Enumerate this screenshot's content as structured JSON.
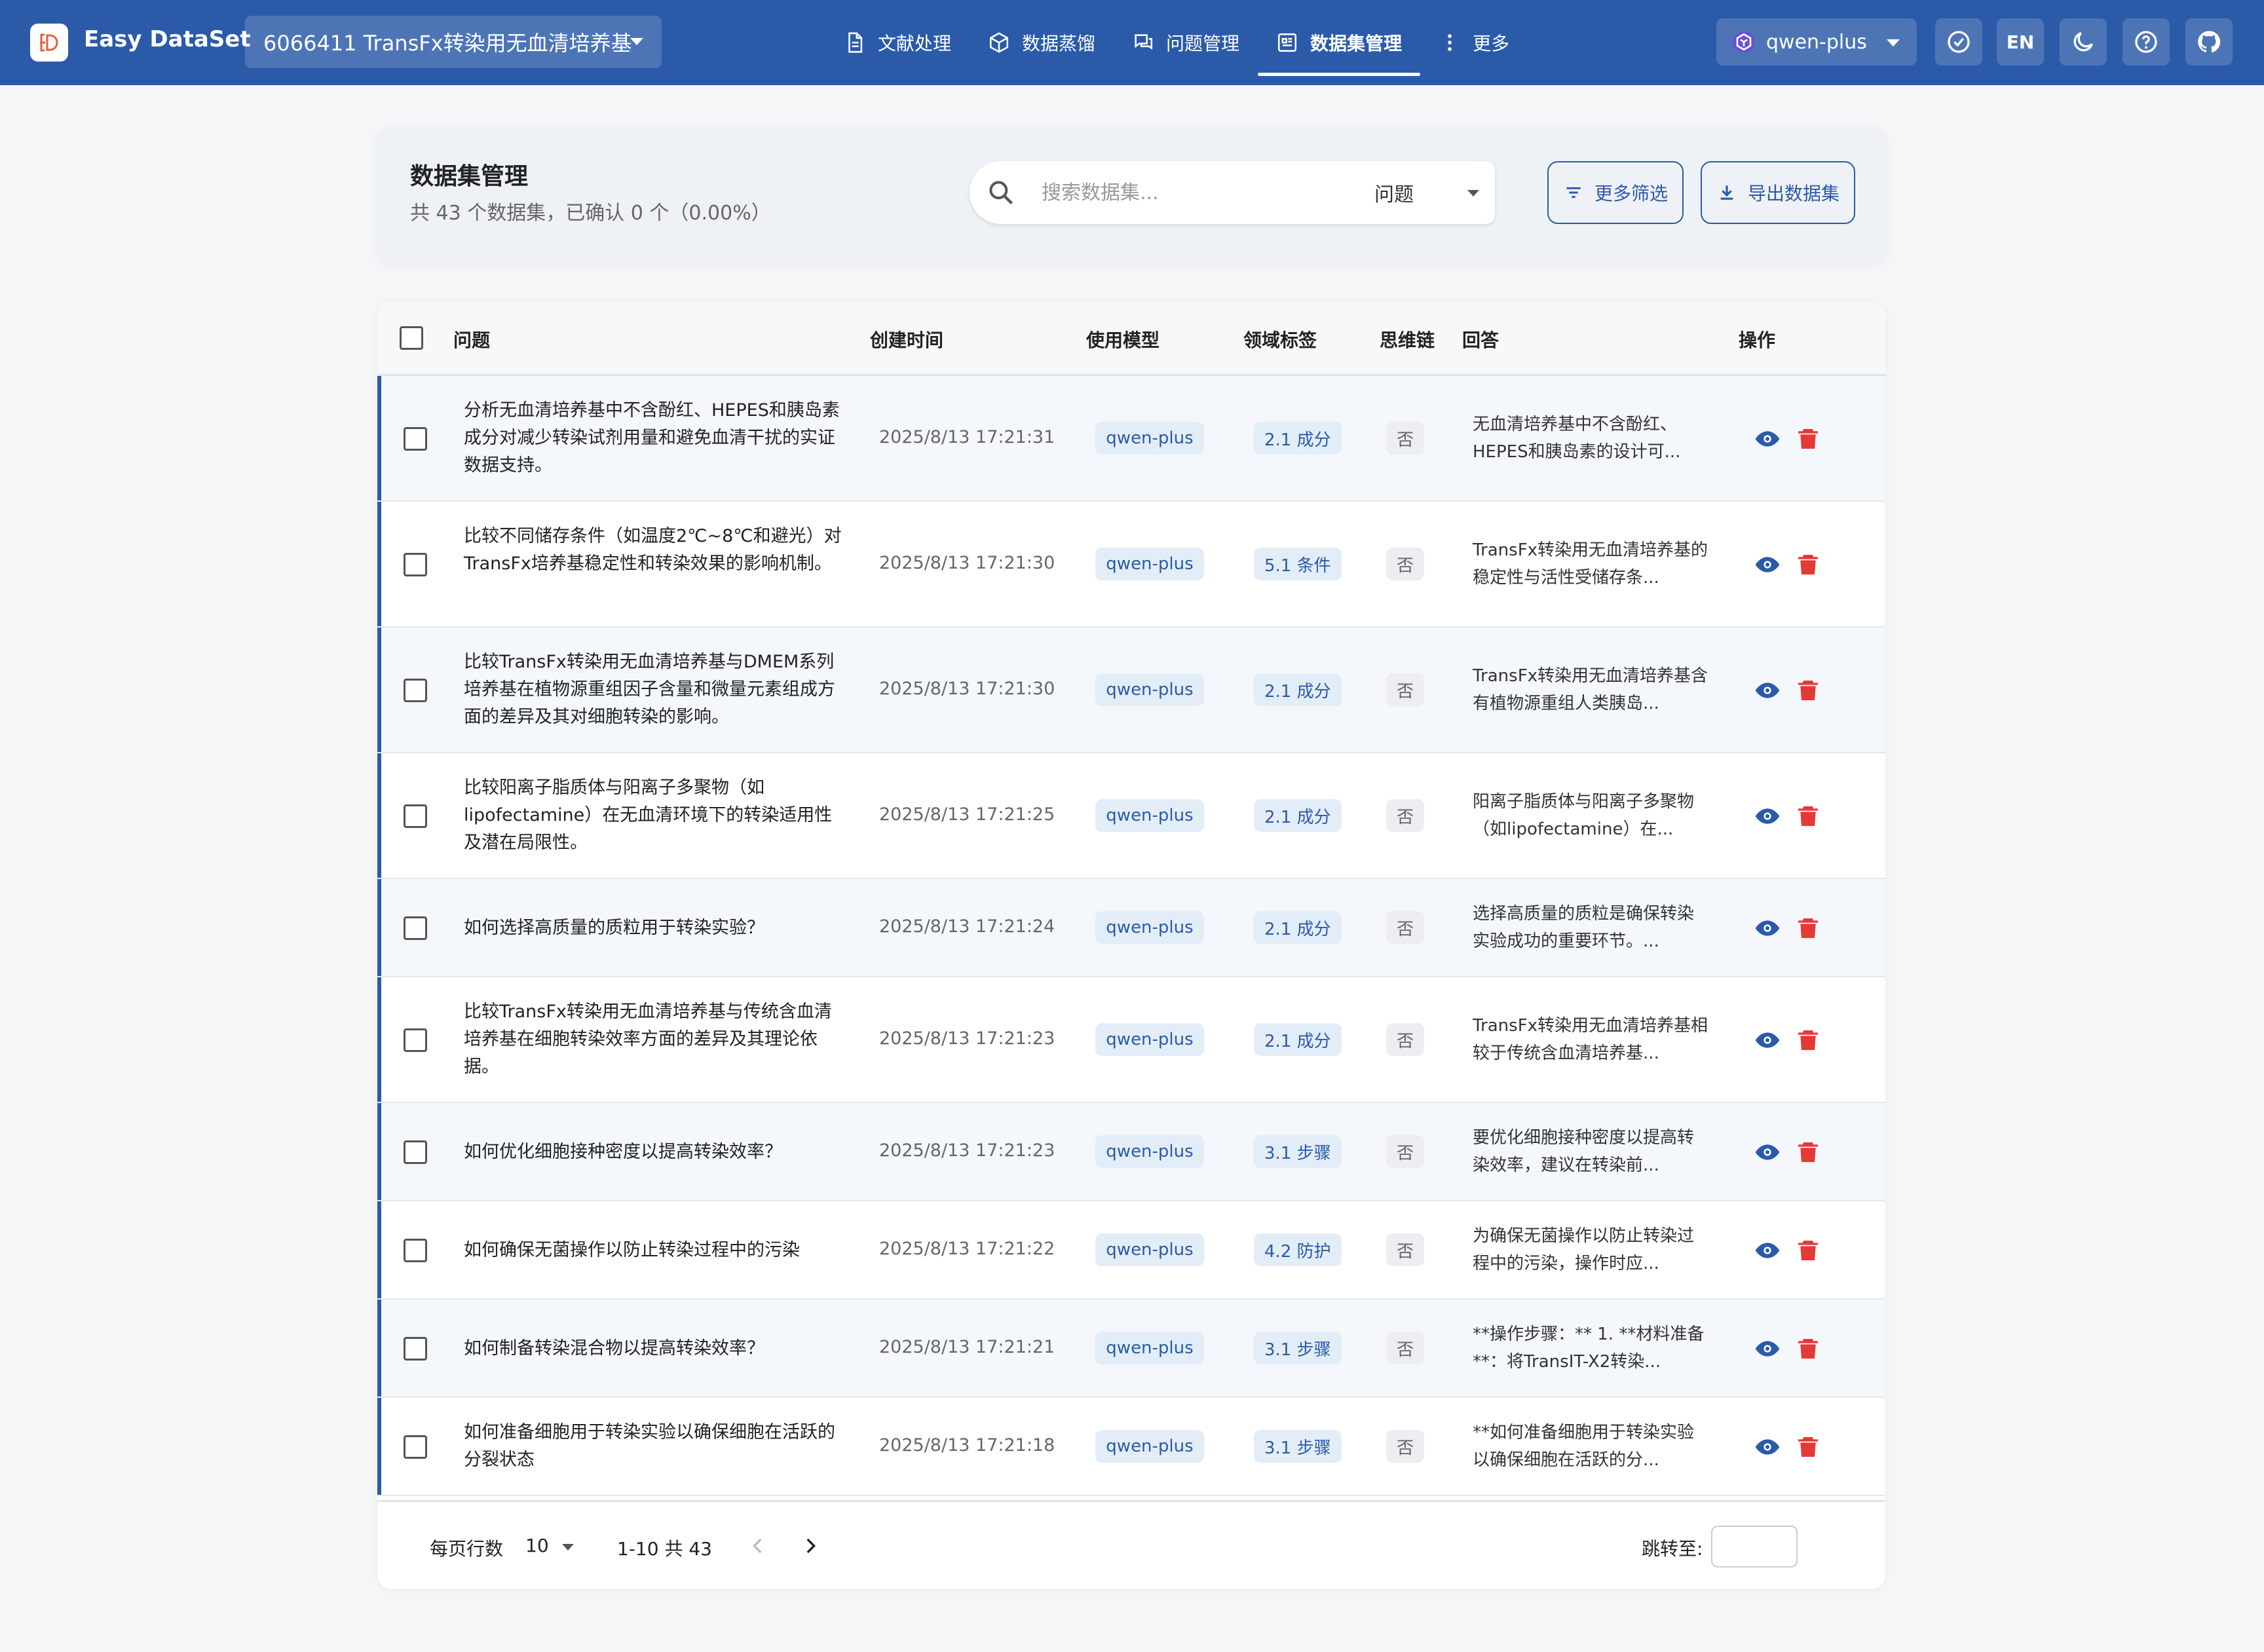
{
  "app": {
    "title": "Easy DataSet",
    "project": "6066411 TransFx转染用无血清培养基",
    "model": "qwen-plus",
    "lang": "EN"
  },
  "nav": [
    {
      "label": "文献处理",
      "icon": "document-icon"
    },
    {
      "label": "数据蒸馏",
      "icon": "cube-icon"
    },
    {
      "label": "问题管理",
      "icon": "chat-icon"
    },
    {
      "label": "数据集管理",
      "icon": "dataset-icon",
      "active": true
    },
    {
      "label": "更多",
      "icon": "more-vertical-icon"
    }
  ],
  "header": {
    "title": "数据集管理",
    "subtitle": "共 43 个数据集，已确认 0 个（0.00%）",
    "search_placeholder": "搜索数据集...",
    "search_field": "问题",
    "more_filters": "更多筛选",
    "export": "导出数据集"
  },
  "table": {
    "columns": {
      "question": "问题",
      "created": "创建时间",
      "model": "使用模型",
      "tag": "领域标签",
      "cot": "思维链",
      "answer": "回答",
      "actions": "操作"
    },
    "rows": [
      {
        "question": "分析无血清培养基中不含酚红、HEPES和胰岛素成分对减少转染试剂用量和避免血清干扰的实证数据支持。",
        "time": "2025/8/13 17:21:31",
        "model": "qwen-plus",
        "tag": "2.1 成分",
        "cot": "否",
        "answer": "无血清培养基中不含酚红、HEPES和胰岛素的设计可..."
      },
      {
        "question": "比较不同储存条件（如温度2℃~8℃和避光）对TransFx培养基稳定性和转染效果的影响机制。",
        "time": "2025/8/13 17:21:30",
        "model": "qwen-plus",
        "tag": "5.1 条件",
        "cot": "否",
        "answer": "TransFx转染用无血清培养基的稳定性与活性受储存条..."
      },
      {
        "question": "比较TransFx转染用无血清培养基与DMEM系列培养基在植物源重组因子含量和微量元素组成方面的差异及其对细胞转染的影响。",
        "time": "2025/8/13 17:21:30",
        "model": "qwen-plus",
        "tag": "2.1 成分",
        "cot": "否",
        "answer": "TransFx转染用无血清培养基含有植物源重组人类胰岛..."
      },
      {
        "question": "比较阳离子脂质体与阳离子多聚物（如lipofectamine）在无血清环境下的转染适用性及潜在局限性。",
        "time": "2025/8/13 17:21:25",
        "model": "qwen-plus",
        "tag": "2.1 成分",
        "cot": "否",
        "answer": "阳离子脂质体与阳离子多聚物（如lipofectamine）在..."
      },
      {
        "question": "如何选择高质量的质粒用于转染实验？",
        "time": "2025/8/13 17:21:24",
        "model": "qwen-plus",
        "tag": "2.1 成分",
        "cot": "否",
        "answer": "选择高质量的质粒是确保转染实验成功的重要环节。..."
      },
      {
        "question": "比较TransFx转染用无血清培养基与传统含血清培养基在细胞转染效率方面的差异及其理论依据。",
        "time": "2025/8/13 17:21:23",
        "model": "qwen-plus",
        "tag": "2.1 成分",
        "cot": "否",
        "answer": "TransFx转染用无血清培养基相较于传统含血清培养基..."
      },
      {
        "question": "如何优化细胞接种密度以提高转染效率？",
        "time": "2025/8/13 17:21:23",
        "model": "qwen-plus",
        "tag": "3.1 步骤",
        "cot": "否",
        "answer": "要优化细胞接种密度以提高转染效率，建议在转染前..."
      },
      {
        "question": "如何确保无菌操作以防止转染过程中的污染",
        "time": "2025/8/13 17:21:22",
        "model": "qwen-plus",
        "tag": "4.2 防护",
        "cot": "否",
        "answer": "为确保无菌操作以防止转染过程中的污染，操作时应..."
      },
      {
        "question": "如何制备转染混合物以提高转染效率？",
        "time": "2025/8/13 17:21:21",
        "model": "qwen-plus",
        "tag": "3.1 步骤",
        "cot": "否",
        "answer": "**操作步骤：** 1. **材料准备**：将TransIT-X2转染..."
      },
      {
        "question": "如何准备细胞用于转染实验以确保细胞在活跃的分裂状态",
        "time": "2025/8/13 17:21:18",
        "model": "qwen-plus",
        "tag": "3.1 步骤",
        "cot": "否",
        "answer": "**如何准备细胞用于转染实验以确保细胞在活跃的分..."
      }
    ]
  },
  "footer": {
    "rows_per_page_label": "每页行数",
    "rows_per_page": "10",
    "range": "1-10 共 43",
    "jump_label": "跳转至:"
  },
  "colors": {
    "primary": "#2b5ba8",
    "delete": "#e53935"
  }
}
